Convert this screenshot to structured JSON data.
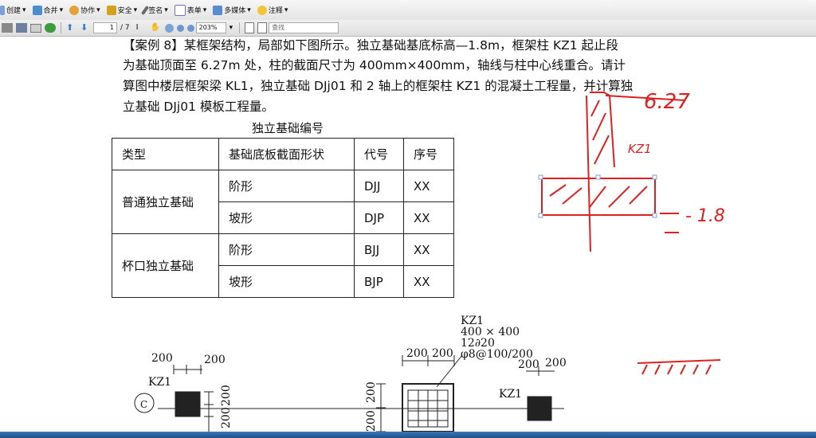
{
  "toolbar": {
    "items": [
      {
        "label": "创建",
        "icon": "create-icon"
      },
      {
        "label": "合并",
        "icon": "merge-icon"
      },
      {
        "label": "协作",
        "icon": "collaborate-icon"
      },
      {
        "label": "安全",
        "icon": "lock-icon"
      },
      {
        "label": "签名",
        "icon": "pen-icon"
      },
      {
        "label": "表单",
        "icon": "form-icon"
      },
      {
        "label": "多媒体",
        "icon": "media-icon"
      },
      {
        "label": "注释",
        "icon": "comment-icon"
      }
    ]
  },
  "nav": {
    "page_current": "1",
    "page_total": "/ 7",
    "zoom": "203%",
    "search_placeholder": "查找"
  },
  "doc": {
    "lines": [
      "【案例 8】某框架结构，局部如下图所示。独立基础基底标高—1.8m，框架柱 KZ1 起止段",
      "为基础顶面至 6.27m 处，柱的截面尺寸为 400mm×400mm，轴线与柱中心线重合。请计",
      "算图中楼层框架梁 KL1，独立基础 DJj01 和 2 轴上的框架柱 KZ1 的混凝土工程量，并计算独",
      "立基础 DJj01 模板工程量。"
    ],
    "table_caption": "独立基础编号",
    "table": {
      "headers": [
        "类型",
        "基础底板截面形状",
        "代号",
        "序号"
      ],
      "groups": [
        {
          "type": "普通独立基础",
          "rows": [
            [
              "阶形",
              "DJJ",
              "XX"
            ],
            [
              "坡形",
              "DJP",
              "XX"
            ]
          ]
        },
        {
          "type": "杯口独立基础",
          "rows": [
            [
              "阶形",
              "BJJ",
              "XX"
            ],
            [
              "坡形",
              "BJP",
              "XX"
            ]
          ]
        }
      ]
    },
    "drawing": {
      "kz1_label": "KZ1",
      "col_size": "400 × 400",
      "rebar1": "12∂20",
      "rebar2": "φ8@100/200",
      "dim_200": "200",
      "axis_label": "C"
    },
    "handwriting": {
      "elev_top": "6.27",
      "kz1": "KZ1",
      "elev_bottom": "- 1.8"
    }
  },
  "colors": {
    "annotation": "#e02020",
    "taskbar": "#2a64a8"
  }
}
